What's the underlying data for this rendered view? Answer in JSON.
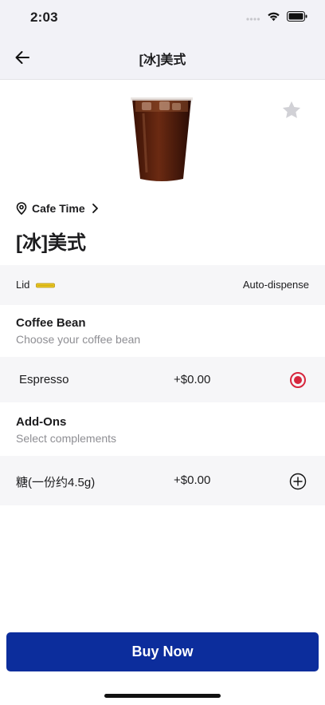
{
  "status_bar": {
    "time": "2:03",
    "icons": [
      "cellular-icon",
      "wifi-icon",
      "battery-icon"
    ]
  },
  "nav": {
    "title": "[冰]美式",
    "back_icon": "arrow-left-icon"
  },
  "product": {
    "name": "[冰]美式",
    "store": "Cafe Time",
    "image": "iced-americano-cup",
    "favorite_icon": "star-icon"
  },
  "lid": {
    "label": "Lid",
    "value": "Auto-dispense",
    "icon": "lid-icon"
  },
  "coffee_bean": {
    "title": "Coffee Bean",
    "subtitle": "Choose your coffee bean",
    "options": [
      {
        "label": "Espresso",
        "price": "+$0.00",
        "selected": true
      }
    ]
  },
  "add_ons": {
    "title": "Add-Ons",
    "subtitle": "Select complements",
    "options": [
      {
        "label": "糖(一份约4.5g)",
        "price": "+$0.00",
        "icon": "plus-circle-icon"
      }
    ]
  },
  "actions": {
    "buy_label": "Buy Now"
  },
  "colors": {
    "accent_red": "#d7263d",
    "primary_blue": "#0c2d9c",
    "lid_yellow": "#e8c520"
  }
}
